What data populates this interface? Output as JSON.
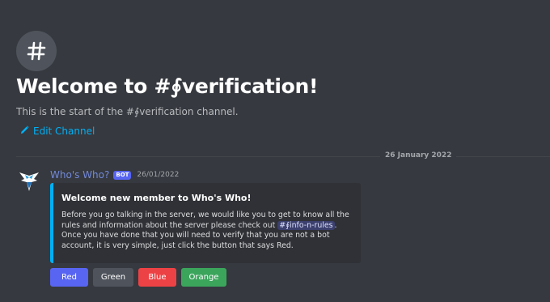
{
  "welcome": {
    "title": "Welcome to #∮verification!",
    "subtitle": "This is the start of the #∮verification channel.",
    "edit_label": "Edit Channel"
  },
  "divider": {
    "date": "26 January 2022"
  },
  "message": {
    "username": "Who's Who?",
    "bot_tag": "BOT",
    "timestamp": "26/01/2022",
    "embed": {
      "accent_color": "#00b0f4",
      "title": "Welcome new member to Who's Who!",
      "line1": "Before you go talking in the server, we would like you to get to know all the rules and information about the server please check out",
      "mention_prefix": "#",
      "mention": "∮info-n-rules",
      "after_mention": ".",
      "line2": "Once you have done that you will need to verify that you are not a bot account, it is very simple, just click the button that says Red."
    },
    "buttons": [
      {
        "label": "Red",
        "color": "#5865f2"
      },
      {
        "label": "Green",
        "color": "#4f545c"
      },
      {
        "label": "Blue",
        "color": "#ed4245"
      },
      {
        "label": "Orange",
        "color": "#3ba55c"
      }
    ]
  },
  "icons": {
    "welcome": "hashtag-icon",
    "edit": "pencil-icon",
    "avatar": "bird-logo-icon"
  }
}
